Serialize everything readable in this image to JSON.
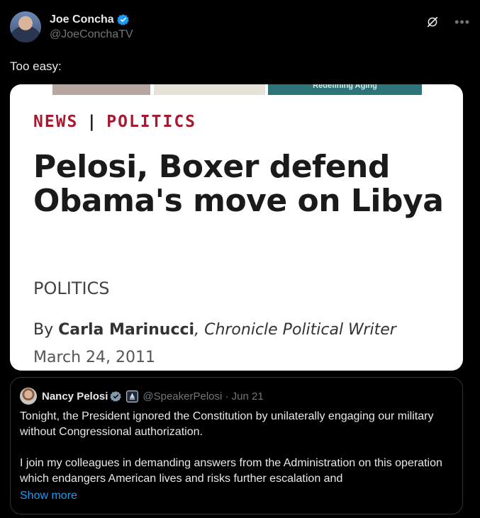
{
  "author": {
    "name": "Joe Concha",
    "handle": "@JoeConchaTV"
  },
  "tweet": {
    "text": "Too easy:"
  },
  "article": {
    "strip_text": "Redefining Aging",
    "kicker_news": "NEWS",
    "kicker_sep": "|",
    "kicker_politics": "POLITICS",
    "headline": "Pelosi, Boxer defend Obama's move on Libya",
    "section": "POLITICS",
    "byline_prefix": "By",
    "byline_author": "Carla Marinucci",
    "byline_role": ", Chronicle Political Writer",
    "date": "March 24, 2011"
  },
  "quote": {
    "name": "Nancy Pelosi",
    "handle_date": "@SpeakerPelosi · Jun 21",
    "paragraph1": "Tonight, the President ignored the Constitution by unilaterally engaging our military without Congressional authorization.",
    "paragraph2": "I join my colleagues in demanding answers from the Administration on this operation which endangers American lives and risks further escalation and",
    "show_more": "Show more"
  },
  "colors": {
    "background": "#000000",
    "accent": "#1d9bf0",
    "kicker": "#a6192e"
  },
  "icons": [
    "verified-badge-icon",
    "grok-icon",
    "more-icon",
    "government-badge-icon"
  ]
}
